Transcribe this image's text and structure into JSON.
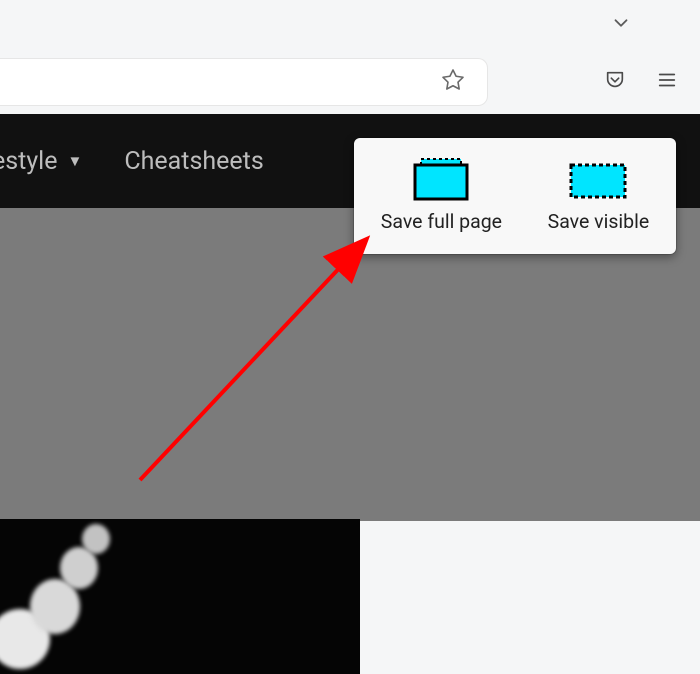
{
  "nav": {
    "item_partial": "estyle",
    "item_cheatsheets": "Cheatsheets"
  },
  "popup": {
    "save_full_page": "Save full page",
    "save_visible": "Save visible"
  }
}
